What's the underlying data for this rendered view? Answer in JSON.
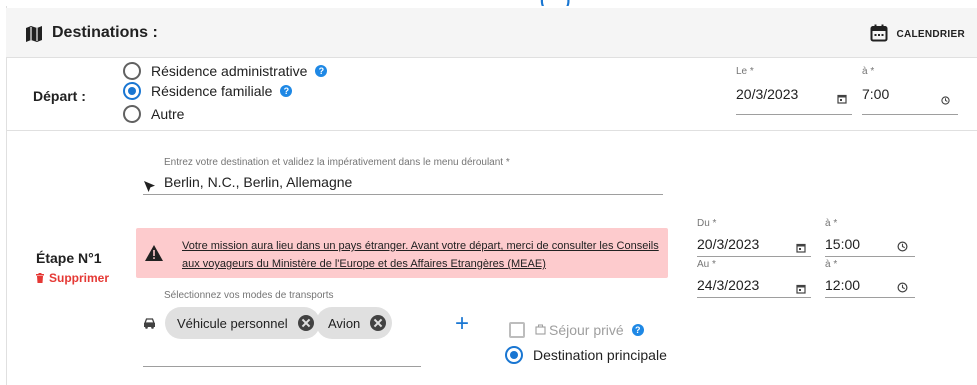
{
  "header": {
    "title": "Destinations :",
    "calendar_label": "CALENDRIER"
  },
  "depart": {
    "label": "Départ :",
    "options": [
      {
        "label": "Résidence administrative",
        "selected": false,
        "help": true
      },
      {
        "label": "Résidence familiale",
        "selected": true,
        "help": true
      },
      {
        "label": "Autre",
        "selected": false,
        "help": false
      }
    ],
    "date_label": "Le *",
    "date_value": "20/3/2023",
    "time_label": "à *",
    "time_value": "7:00"
  },
  "etape": {
    "label": "Étape N°1",
    "delete_label": "Supprimer",
    "destination_label": "Entrez votre destination et validez la impérativement dans le menu déroulant *",
    "destination_value": "Berlin, N.C., Berlin, Allemagne",
    "alert_text": "Votre mission aura lieu dans un pays étranger. Avant votre départ, merci de consulter les Conseils aux voyageurs du Ministère de l'Europe et des Affaires Etrangères (MEAE)",
    "du_label": "Du *",
    "du_value": "20/3/2023",
    "du_time_label": "à *",
    "du_time_value": "15:00",
    "au_label": "Au *",
    "au_value": "24/3/2023",
    "au_time_label": "à *",
    "au_time_value": "12:00",
    "modes_label": "Sélectionnez vos modes de transports",
    "modes": [
      "Véhicule personnel",
      "Avion"
    ],
    "add_symbol": "+",
    "sejour_prive_label": "Séjour privé",
    "destination_principale_label": "Destination principale"
  },
  "colors": {
    "accent": "#1976d2",
    "alert_bg": "#fdcbcd",
    "danger": "#e53935",
    "header_bg": "#f5f5f5"
  }
}
